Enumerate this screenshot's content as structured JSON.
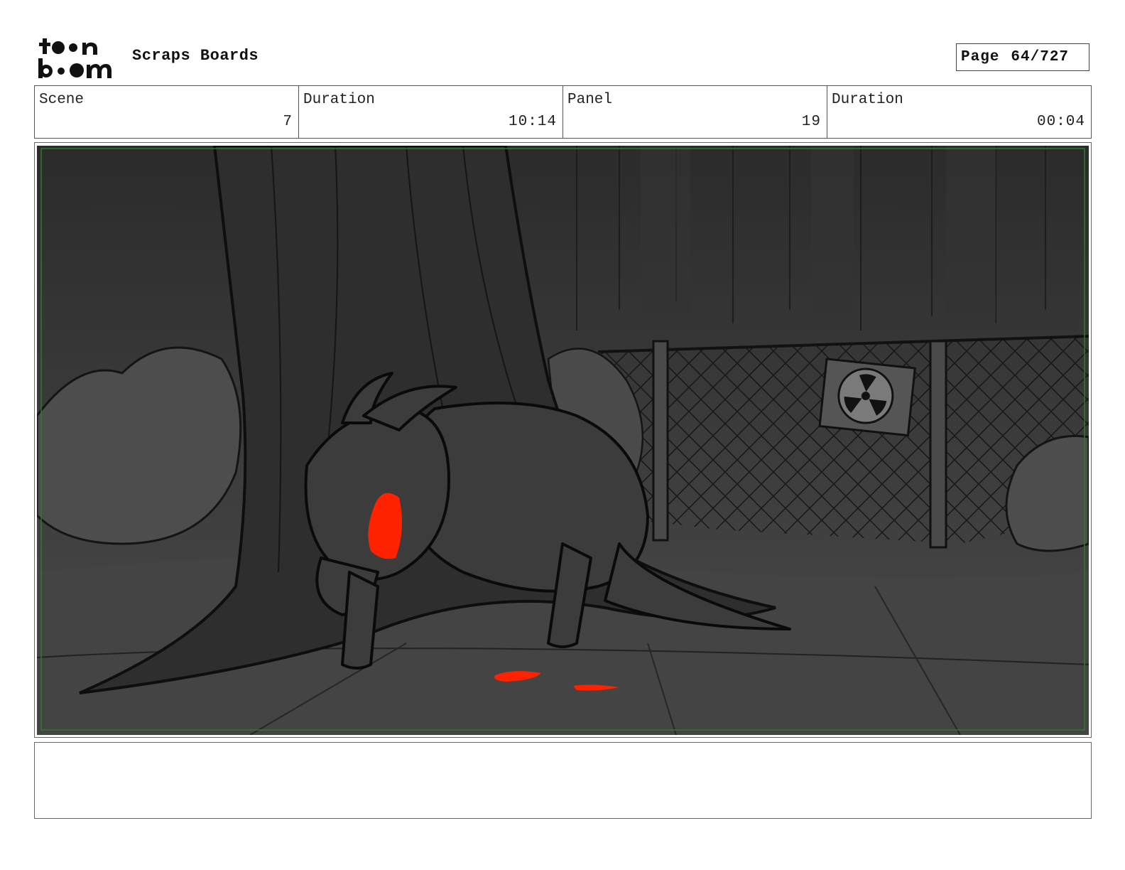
{
  "header": {
    "logo_text": "toon boom",
    "project_title": "Scraps Boards",
    "page_label": "Page",
    "page_number": "64/727"
  },
  "info": [
    {
      "label": "Scene",
      "value": "7"
    },
    {
      "label": "Duration",
      "value": "10:14"
    },
    {
      "label": "Panel",
      "value": "19"
    },
    {
      "label": "Duration",
      "value": "00:04"
    }
  ],
  "panel": {
    "description": "",
    "colors": {
      "background": "#3a3a3a",
      "safe_frame": "#2f7a2f",
      "accent_blood": "#ff2200"
    }
  },
  "notes": {
    "text": ""
  }
}
